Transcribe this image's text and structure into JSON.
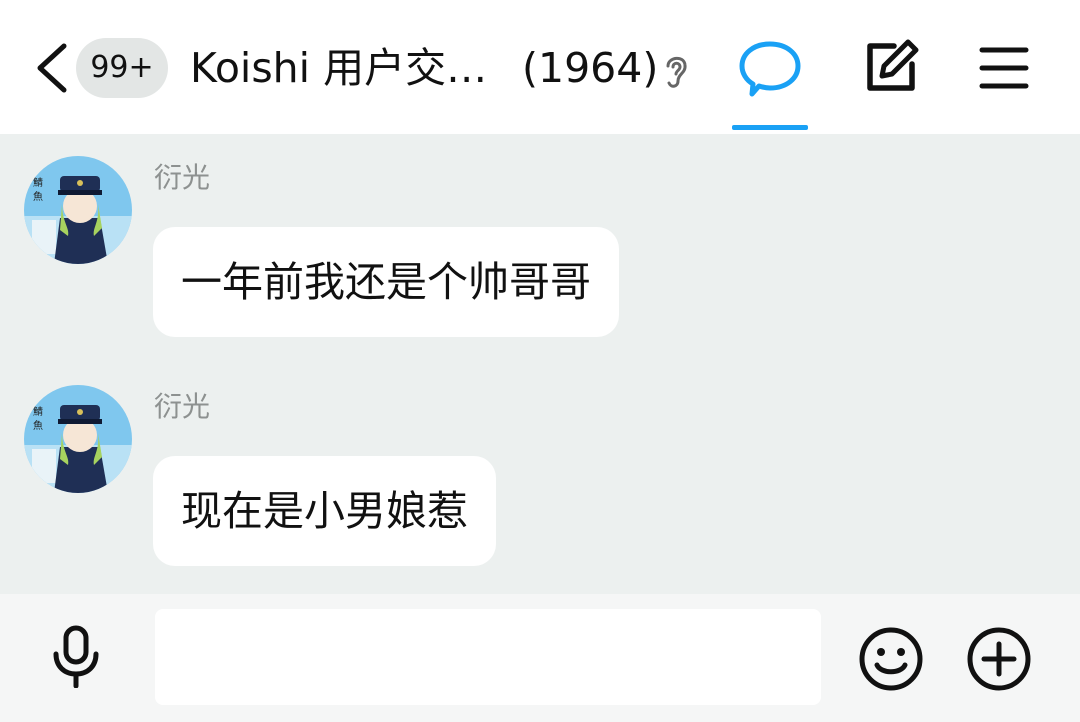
{
  "header": {
    "unread_badge": "99+",
    "title": "Koishi 用户交…",
    "member_count": "(1964)",
    "icons": {
      "back": "chevron-left-icon",
      "ear": "ear-icon",
      "chat_tab": "speech-bubble-icon",
      "edit": "edit-square-icon",
      "menu": "hamburger-icon"
    },
    "accent_color": "#1aa1f5"
  },
  "messages": [
    {
      "sender": "衍光",
      "text": "一年前我还是个帅哥哥"
    },
    {
      "sender": "衍光",
      "text": "现在是小男娘惹"
    }
  ],
  "input_bar": {
    "value": "",
    "placeholder": "",
    "icons": {
      "voice": "microphone-icon",
      "emoji": "smiley-icon",
      "more": "plus-circle-icon"
    }
  }
}
